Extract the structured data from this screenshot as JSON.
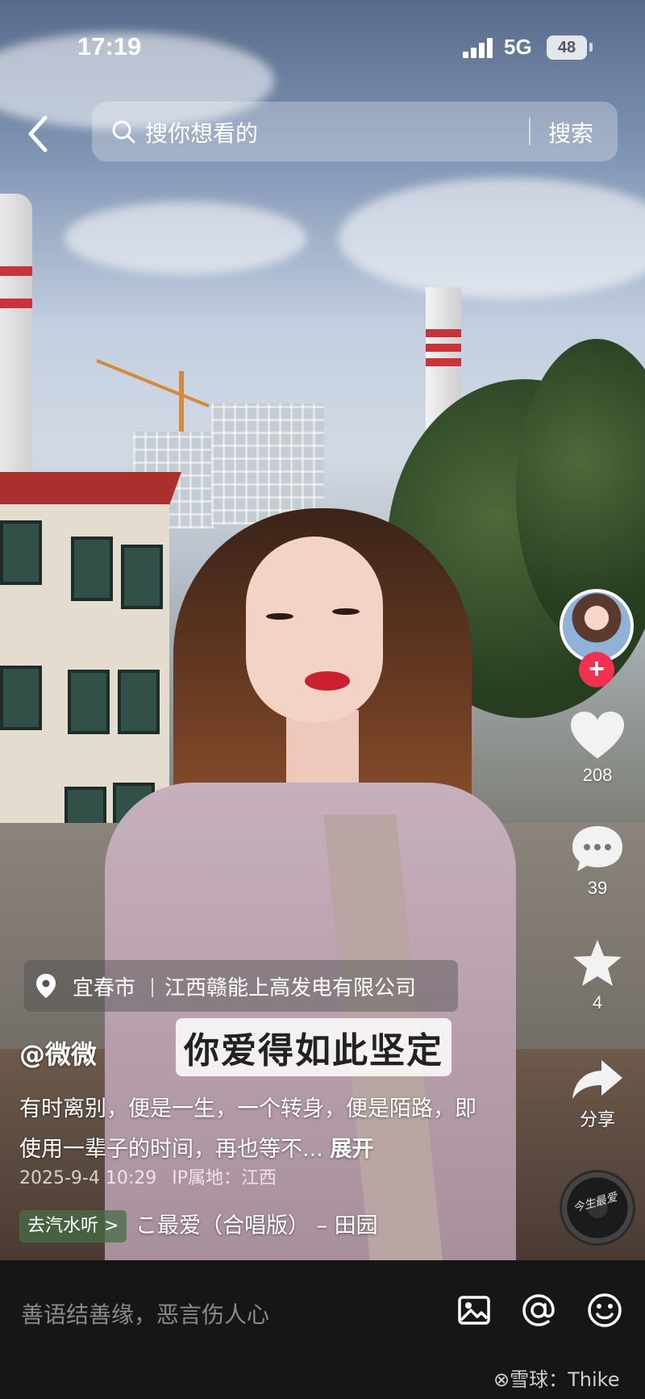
{
  "status_bar": {
    "time": "17:19",
    "network": "5G",
    "battery": "48"
  },
  "search": {
    "placeholder": "搜你想看的",
    "button": "搜索"
  },
  "location": {
    "city": "宜春市",
    "poi": "江西赣能上高发电有限公司"
  },
  "video": {
    "subtitle": "你爱得如此坚定",
    "author": "@微微",
    "caption": "有时离别，便是一生，一个转身，便是陌路，即使用一辈子的时间，再也等不...",
    "expand_label": "展开",
    "datetime": "2025-9-4 10:29",
    "ip_location": "IP属地：江西"
  },
  "music": {
    "tag": "去汽水听 >",
    "title": "こ最爱（合唱版） – 田园"
  },
  "actions": {
    "likes": "208",
    "comments": "39",
    "favorites": "4",
    "share_label": "分享"
  },
  "disc": {
    "label": "今生最爱"
  },
  "comment_bar": {
    "placeholder": "善语结善缘，恶言伤人心"
  },
  "watermark": "⊗雪球：Thike",
  "colors": {
    "follow_button": "#f2304f",
    "bottom_bar": "#161616"
  },
  "icons": [
    "back-icon",
    "search-icon",
    "location-pin-icon",
    "heart-icon",
    "comment-icon",
    "star-icon",
    "share-icon",
    "image-icon",
    "at-icon",
    "emoji-icon",
    "plus-icon"
  ]
}
